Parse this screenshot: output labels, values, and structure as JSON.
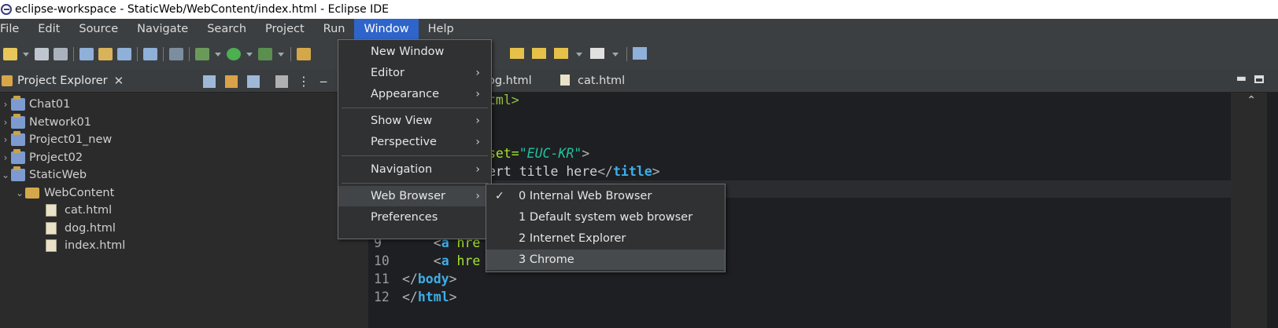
{
  "window": {
    "title": "eclipse-workspace - StaticWeb/WebContent/index.html - Eclipse IDE"
  },
  "menubar": [
    "File",
    "Edit",
    "Source",
    "Navigate",
    "Search",
    "Project",
    "Run",
    "Window",
    "Help"
  ],
  "explorer": {
    "title": "Project Explorer",
    "tree": [
      {
        "label": "Chat01",
        "level": 0,
        "kind": "project",
        "expanded": false
      },
      {
        "label": "Network01",
        "level": 0,
        "kind": "project",
        "expanded": false
      },
      {
        "label": "Project01_new",
        "level": 0,
        "kind": "project",
        "expanded": false
      },
      {
        "label": "Project02",
        "level": 0,
        "kind": "project",
        "expanded": false
      },
      {
        "label": "StaticWeb",
        "level": 0,
        "kind": "project",
        "expanded": true
      },
      {
        "label": "WebContent",
        "level": 1,
        "kind": "folder",
        "expanded": true
      },
      {
        "label": "cat.html",
        "level": 2,
        "kind": "file"
      },
      {
        "label": "dog.html",
        "level": 2,
        "kind": "file"
      },
      {
        "label": "index.html",
        "level": 2,
        "kind": "file"
      }
    ]
  },
  "editor": {
    "tabs": [
      "og.html",
      "cat.html"
    ],
    "code": {
      "l1_tail": "tml>",
      "l4_attr": "set=",
      "l4_val": "\"EUC-KR\"",
      "l4_end": ">",
      "l5_text": "ert title here",
      "l5_close_open": "</",
      "l5_tag": "title",
      "l5_close_end": ">",
      "lines": [
        {
          "num": "9",
          "lt": "<",
          "tag": "a",
          "attr": " hre"
        },
        {
          "num": "10",
          "lt": "<",
          "tag": "a",
          "attr": " hre"
        },
        {
          "num": "11",
          "lt": "</",
          "tag": "body",
          "gt": ">"
        },
        {
          "num": "12",
          "lt": "</",
          "tag": "html",
          "gt": ">"
        }
      ]
    }
  },
  "window_menu": {
    "items": [
      "New Window",
      "Editor",
      "Appearance",
      "Show View",
      "Perspective",
      "Navigation",
      "Web Browser",
      "Preferences"
    ],
    "submenu_arrow": "›"
  },
  "web_browser_submenu": {
    "items": [
      "0 Internal Web Browser",
      "1 Default system web browser",
      "2 Internet Explorer",
      "3 Chrome"
    ],
    "checked_index": 0,
    "check_mark": "✓"
  }
}
